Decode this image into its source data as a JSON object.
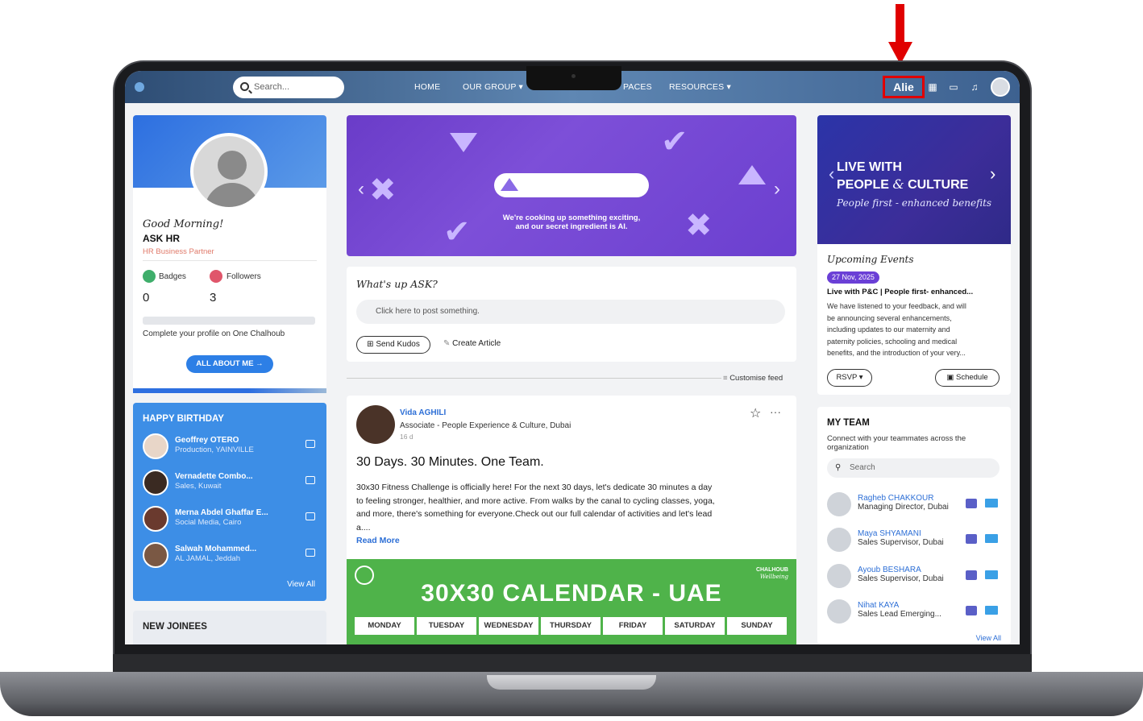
{
  "nav": {
    "search_placeholder": "Search...",
    "items": [
      "HOME",
      "OUR GROUP",
      "PACES",
      "RESOURCES"
    ],
    "alie_label": "Alie"
  },
  "profile": {
    "greeting": "Good Morning!",
    "name": "ASK HR",
    "role": "HR Business Partner",
    "badges_label": "Badges",
    "badges_count": "0",
    "followers_label": "Followers",
    "followers_count": "3",
    "complete_text": "Complete your profile on One Chalhoub",
    "all_about_me": "ALL ABOUT ME →"
  },
  "birthday": {
    "title": "HAPPY BIRTHDAY",
    "people": [
      {
        "name": "Geoffrey OTERO",
        "sub": "Production, YAINVILLE"
      },
      {
        "name": "Vernadette Combo...",
        "sub": "Sales, Kuwait"
      },
      {
        "name": "Merna Abdel Ghaffar E...",
        "sub": "Social Media, Cairo"
      },
      {
        "name": "Salwah Mohammed...",
        "sub": "AL JAMAL, Jeddah"
      }
    ],
    "view_all": "View All"
  },
  "new_joinees": {
    "title": "NEW JOINEES"
  },
  "banner": {
    "line1": "We're cooking up something exciting,",
    "line2": "and our secret ingredient is AI."
  },
  "composer": {
    "prompt": "What's up ASK?",
    "input_placeholder": "Click here to post something.",
    "send_kudos": "Send Kudos",
    "create_article": "Create Article",
    "customise_feed": "Customise feed"
  },
  "post": {
    "author": "Vida AGHILI",
    "author_role": "Associate - People Experience & Culture, Dubai",
    "age": "16 d",
    "title": "30 Days. 30 Minutes. One Team.",
    "body_lines": [
      "30x30 Fitness Challenge is officially here! For the next 30 days, let's dedicate 30 minutes a day",
      "to feeling stronger, healthier, and more active. From walks by the canal to cycling classes, yoga,",
      "and more, there's something for everyone.Check out our full calendar of activities and let's lead",
      "a...."
    ],
    "read_more": "Read More",
    "calendar_title": "30X30 CALENDAR - UAE",
    "calendar_brand": "CHALHOUB",
    "calendar_brand_sub": "Wellbeing",
    "days": [
      "MONDAY",
      "TUESDAY",
      "WEDNESDAY",
      "THURSDAY",
      "FRIDAY",
      "SATURDAY",
      "SUNDAY"
    ]
  },
  "event_banner": {
    "line1": "LIVE WITH",
    "line2a": "PEOPLE",
    "line2b": "&",
    "line2c": "CULTURE",
    "line3": "People first - enhanced benefits"
  },
  "events": {
    "title": "Upcoming Events",
    "date": "27 Nov, 2025",
    "event_title": "Live with P&C | People first- enhanced...",
    "desc_lines": [
      "We have listened to your feedback, and will",
      "be announcing several enhancements,",
      "including updates to our maternity and",
      "paternity policies, schooling and medical",
      "benefits, and the introduction of your very..."
    ],
    "rsvp": "RSVP",
    "schedule": "Schedule"
  },
  "team": {
    "title": "MY TEAM",
    "desc_line1": "Connect with your teammates across the",
    "desc_line2": "organization",
    "search_placeholder": "Search",
    "members": [
      {
        "name": "Ragheb CHAKKOUR",
        "sub": "Managing Director, Dubai"
      },
      {
        "name": "Maya SHYAMANI",
        "sub": "Sales Supervisor, Dubai"
      },
      {
        "name": "Ayoub BESHARA",
        "sub": "Sales Supervisor, Dubai"
      },
      {
        "name": "Nihat KAYA",
        "sub": "Sales Lead Emerging..."
      }
    ],
    "view_all": "View All"
  },
  "colors": {
    "accent_red": "#e00000",
    "brand_blue": "#2d6fd6",
    "banner_purple": "#7d4fd8",
    "calendar_green": "#4fb34a"
  }
}
